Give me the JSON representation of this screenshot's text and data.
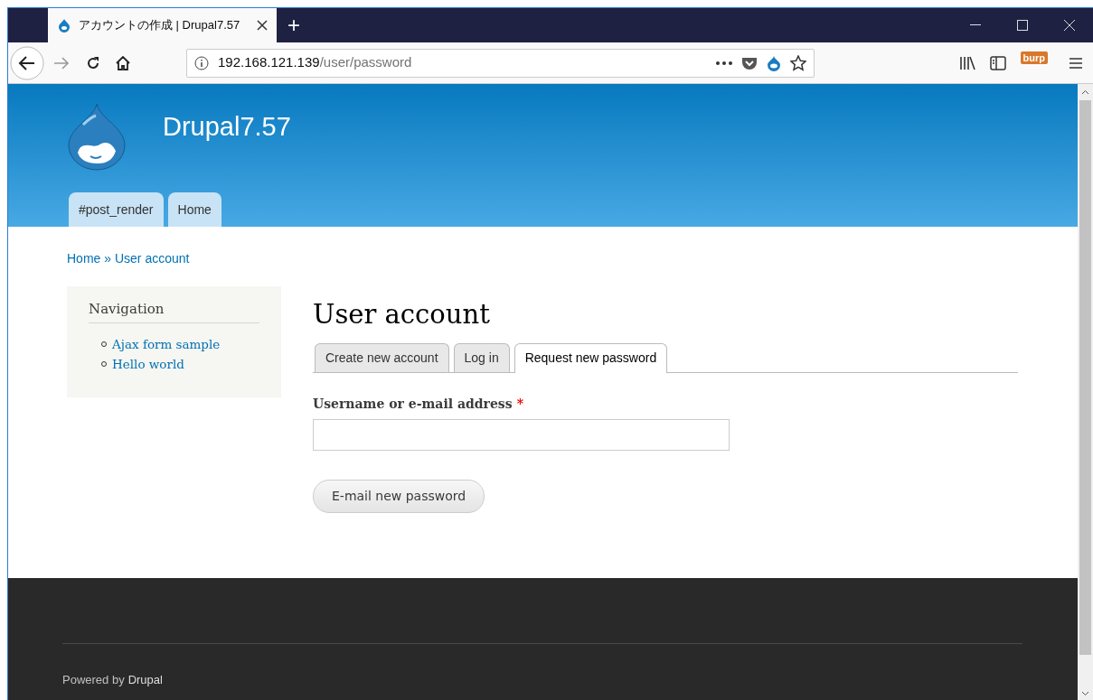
{
  "browser": {
    "tab": {
      "title": "アカウントの作成 | Drupal7.57",
      "selected": true
    },
    "new_tab": "+",
    "address": {
      "host": "192.168.121.139",
      "path": "/user/password"
    },
    "burp_label": "burp"
  },
  "site": {
    "name": "Drupal7.57",
    "primary_tabs": [
      {
        "label": "#post_render"
      },
      {
        "label": "Home"
      }
    ]
  },
  "breadcrumb": {
    "items": [
      "Home",
      "User account"
    ],
    "separator": "»"
  },
  "sidebar": {
    "title": "Navigation",
    "links": [
      "Ajax form sample",
      "Hello world"
    ]
  },
  "main": {
    "title": "User account",
    "tabs": [
      {
        "label": "Create new account",
        "selected": false
      },
      {
        "label": "Log in",
        "selected": false
      },
      {
        "label": "Request new password",
        "selected": true
      }
    ],
    "field": {
      "label": "Username or e-mail address",
      "required_mark": "*"
    },
    "button": "E-mail new password"
  },
  "footer": {
    "prefix": "Powered by",
    "link": "Drupal"
  }
}
